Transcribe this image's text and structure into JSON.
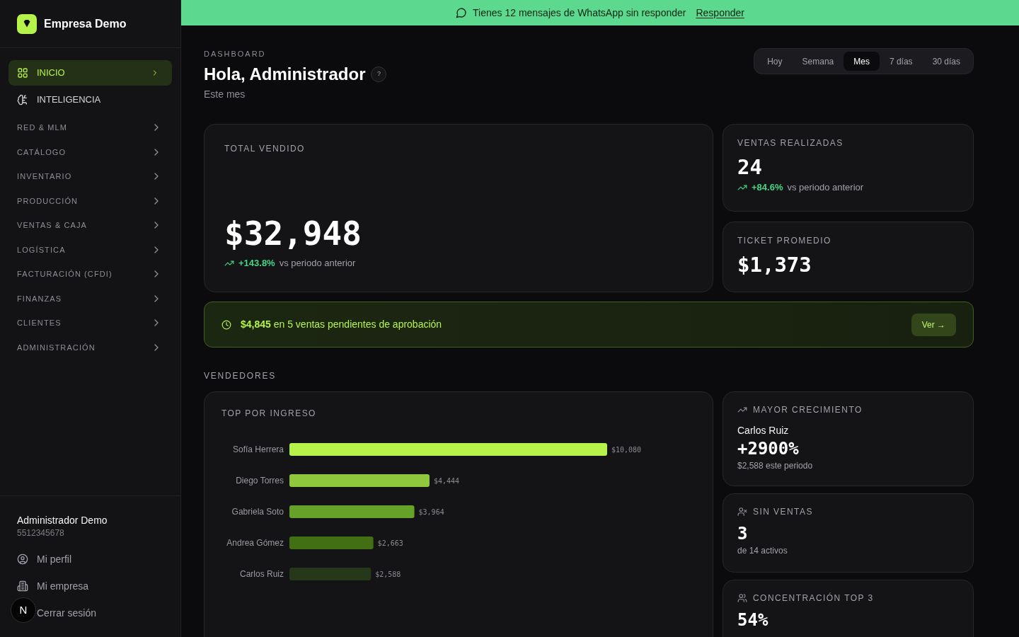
{
  "sidebar": {
    "brand": {
      "name": "Empresa Demo"
    },
    "nav": [
      {
        "kind": "link",
        "label": "INICIO",
        "selected": true
      },
      {
        "kind": "link",
        "label": "INTELIGENCIA",
        "selected": false
      },
      {
        "kind": "group",
        "label": "RED & MLM",
        "selected": false,
        "expanded": false
      },
      {
        "kind": "group",
        "label": "CATÁLOGO",
        "selected": false,
        "expanded": false
      },
      {
        "kind": "group",
        "label": "INVENTARIO",
        "selected": false,
        "expanded": false
      },
      {
        "kind": "group",
        "label": "PRODUCCIÓN",
        "selected": false,
        "expanded": false
      },
      {
        "kind": "group",
        "label": "VENTAS & CAJA",
        "selected": false,
        "expanded": false
      },
      {
        "kind": "group",
        "label": "LOGÍSTICA",
        "selected": false,
        "expanded": false
      },
      {
        "kind": "group",
        "label": "FACTURACIÓN (CFDI)",
        "selected": false,
        "expanded": false
      },
      {
        "kind": "group",
        "label": "FINANZAS",
        "selected": false,
        "expanded": false
      },
      {
        "kind": "group",
        "label": "CLIENTES",
        "selected": false,
        "expanded": false
      },
      {
        "kind": "group",
        "label": "ADMINISTRACIÓN",
        "selected": false,
        "expanded": false
      }
    ],
    "user": {
      "name": "Administrador Demo",
      "phone": "5512345678"
    },
    "account_menu": [
      {
        "label": "Mi perfil"
      },
      {
        "label": "Mi empresa"
      },
      {
        "label": "Cerrar sesión"
      }
    ]
  },
  "dev_badge": {
    "label": "N"
  },
  "banner": {
    "message": "Tienes 12 mensajes de WhatsApp sin responder",
    "link": "Responder"
  },
  "header": {
    "eyebrow": "DASHBOARD",
    "title": "Hola, Administrador",
    "help": "?",
    "subtitle": "Este mes"
  },
  "period_tabs": [
    {
      "label": "Hoy",
      "selected": false
    },
    {
      "label": "Semana",
      "selected": false
    },
    {
      "label": "Mes",
      "selected": true
    },
    {
      "label": "7 días",
      "selected": false
    },
    {
      "label": "30 días",
      "selected": false
    }
  ],
  "kpis": {
    "total": {
      "label": "TOTAL VENDIDO",
      "value": "$32,948",
      "change": "+143.8%",
      "comparison": "vs periodo anterior"
    },
    "side": [
      {
        "label": "VENTAS REALIZADAS",
        "value": "24",
        "change": "+84.6%",
        "comparison": "vs periodo anterior"
      },
      {
        "label": "TICKET PROMEDIO",
        "value": "$1,373"
      }
    ]
  },
  "pending_alert": {
    "text": "**$4,845** en 5 ventas pendientes de aprobación",
    "button": "Ver →"
  },
  "sellers": {
    "heading": "VENDEDORES",
    "top_chart": {
      "chart_data": {
        "type": "bar",
        "orientation": "horizontal",
        "title": "TOP POR INGRESO",
        "categories": [
          "Sofía Herrera",
          "Diego Torres",
          "Gabriela Soto",
          "Andrea Gómez",
          "Carlos Ruiz"
        ],
        "values": [
          10080,
          4444,
          3964,
          2663,
          2588
        ],
        "value_labels": [
          "$10,080",
          "$4,444",
          "$3,964",
          "$2,663",
          "$2,588"
        ]
      }
    },
    "cards": [
      {
        "title": "MAYOR CRECIMIENTO",
        "name": "Carlos Ruiz",
        "value": "+2900%",
        "note": "$2,588 este periodo"
      },
      {
        "title": "SIN VENTAS",
        "value": "3",
        "note": "de 14 activos"
      },
      {
        "title": "CONCENTRACIÓN TOP 3",
        "value": "54%"
      }
    ]
  }
}
